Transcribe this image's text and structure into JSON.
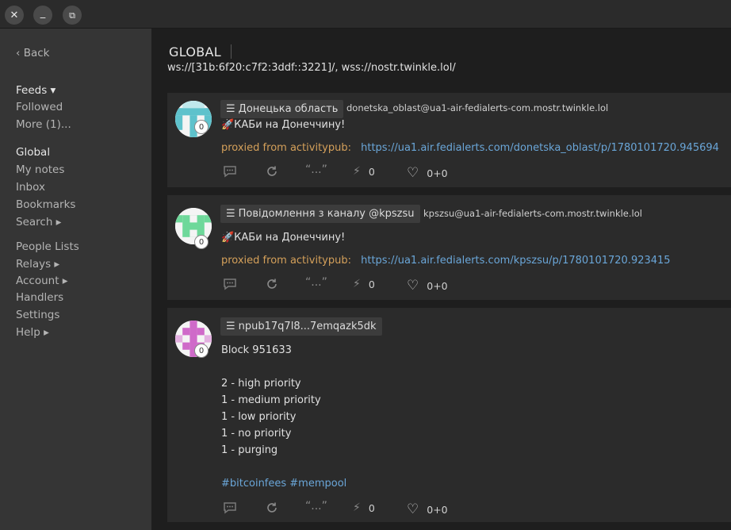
{
  "window": {
    "close_glyph": "✕",
    "minimize_glyph": "_",
    "maximize_glyph": "⧉"
  },
  "sidebar": {
    "back": "‹ Back",
    "feeds": "Feeds ▾",
    "followed": "Followed",
    "more": "More (1)...",
    "global": "Global",
    "my_notes": "My notes",
    "inbox": "Inbox",
    "bookmarks": "Bookmarks",
    "search": "Search ▸",
    "people_lists": "People Lists",
    "relays": "Relays ▸",
    "account": "Account ▸",
    "handlers": "Handlers",
    "settings": "Settings",
    "help": "Help ▸"
  },
  "feed": {
    "title": "GLOBAL",
    "relays": "ws://[31b:6f20:c7f2:3ddf::3221]/, wss://nostr.twinkle.lol/"
  },
  "icons": {
    "reply": "reply-icon",
    "repost": "repost-icon",
    "quote": "“...”",
    "zap": "⚡",
    "like": "♡",
    "menu": "☰"
  },
  "notes": [
    {
      "author": "Донецька область",
      "nip05": "donetska_oblast@ua1-air-fedialerts-com.mostr.twinkle.lol",
      "badge": "0",
      "avatar_color": "#5ec2cc",
      "text": "🚀КАБи на Донеччину!",
      "proxied_label": "proxied from activitypub:",
      "proxied_url": "https://ua1.air.fedialerts.com/donetska_oblast/p/1780101720.945694",
      "zaps": "0",
      "likes": "0+0"
    },
    {
      "author": "Повідомлення з каналу @kpszsu",
      "nip05": "kpszsu@ua1-air-fedialerts-com.mostr.twinkle.lol",
      "badge": "0",
      "avatar_color": "#6ed89a",
      "text": "🚀КАБи на Донеччину!",
      "proxied_label": "proxied from activitypub:",
      "proxied_url": "https://ua1.air.fedialerts.com/kpszsu/p/1780101720.923415",
      "zaps": "0",
      "likes": "0+0"
    },
    {
      "author": "npub17q7l8...7emqazk5dk",
      "badge": "0",
      "avatar_color": "#cf6ac9",
      "lines": [
        "Block 951633",
        "2 - high priority",
        "1 - medium priority",
        "1 - low priority",
        "1 - no priority",
        "1 - purging"
      ],
      "hashtags": "#bitcoinfees #mempool",
      "zaps": "0",
      "likes": "0+0"
    }
  ]
}
